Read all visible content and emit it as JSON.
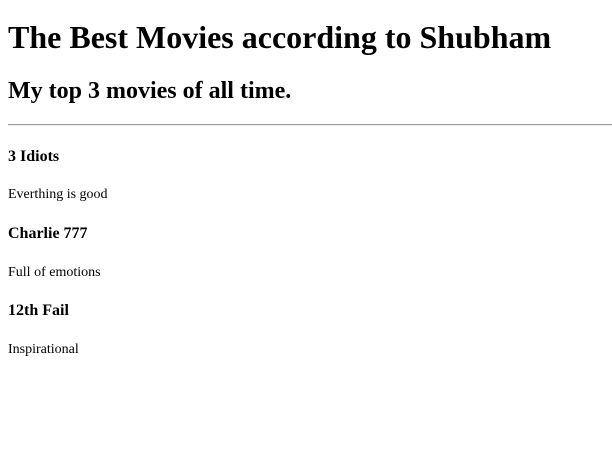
{
  "page": {
    "title": "The Best Movies according to Shubham",
    "subtitle": "My top 3 movies of all time."
  },
  "movies": [
    {
      "name": "3 Idiots",
      "description": "Everthing is good"
    },
    {
      "name": "Charlie 777",
      "description": "Full of emotions"
    },
    {
      "name": "12th Fail",
      "description": "Inspirational"
    }
  ]
}
